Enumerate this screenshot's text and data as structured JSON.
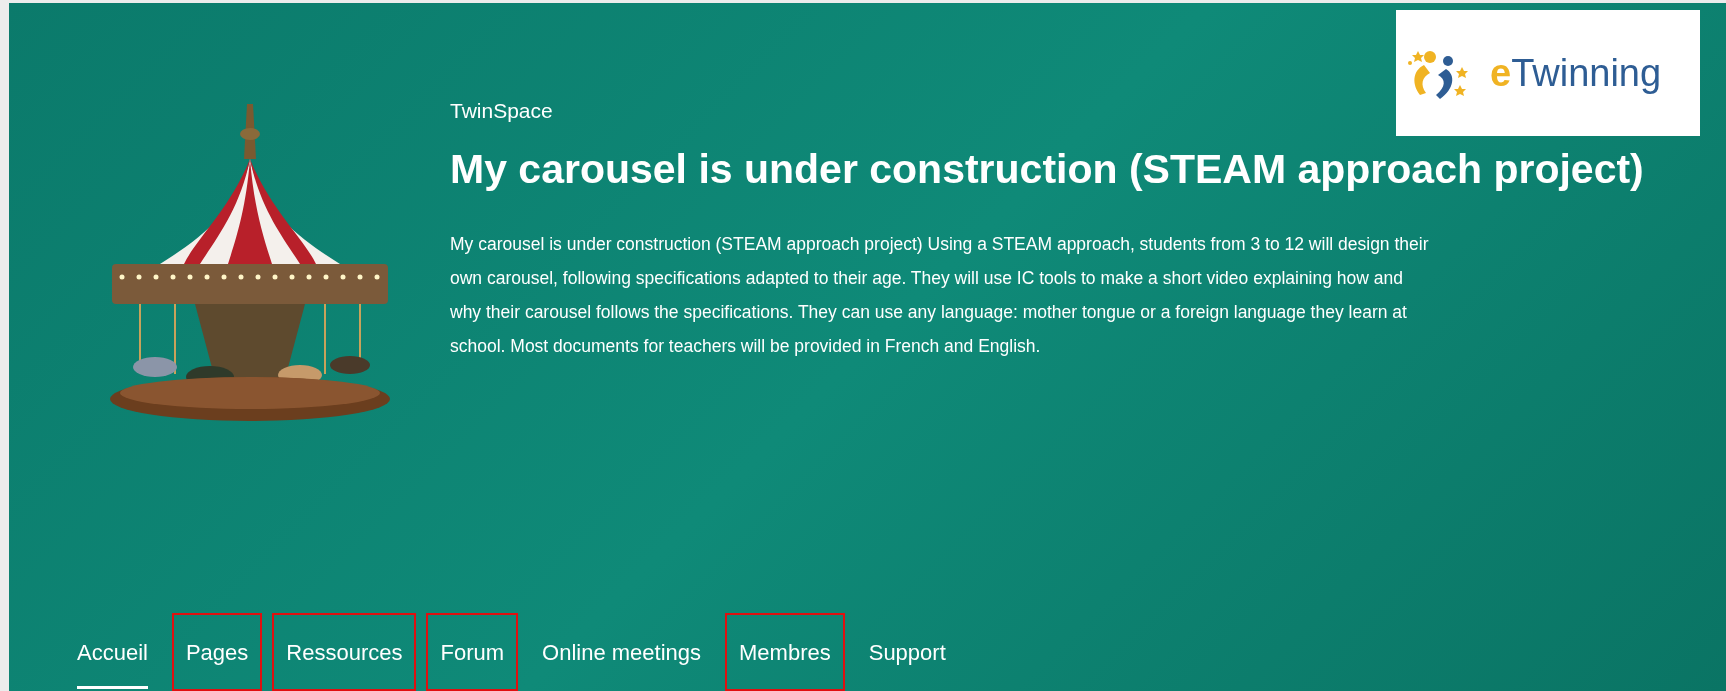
{
  "header": {
    "kicker": "TwinSpace",
    "title": "My carousel is under construction (STEAM approach project)",
    "description": "My carousel is under construction (STEAM approach project) Using a STEAM approach, students from 3 to 12 will design their own carousel, following specifications adapted to their age. They will use IC tools to make a short video explaining how and why their carousel follows the specifications. They can use any language: mother tongue or a foreign language they learn at school. Most documents for teachers will be provided in French and English."
  },
  "logo": {
    "text": "eTwinning"
  },
  "tabs": [
    {
      "label": "Accueil",
      "selected": true,
      "highlighted": false
    },
    {
      "label": "Pages",
      "selected": false,
      "highlighted": true
    },
    {
      "label": "Ressources",
      "selected": false,
      "highlighted": true
    },
    {
      "label": "Forum",
      "selected": false,
      "highlighted": true
    },
    {
      "label": "Online meetings",
      "selected": false,
      "highlighted": false
    },
    {
      "label": "Membres",
      "selected": false,
      "highlighted": true
    },
    {
      "label": "Support",
      "selected": false,
      "highlighted": false
    }
  ]
}
